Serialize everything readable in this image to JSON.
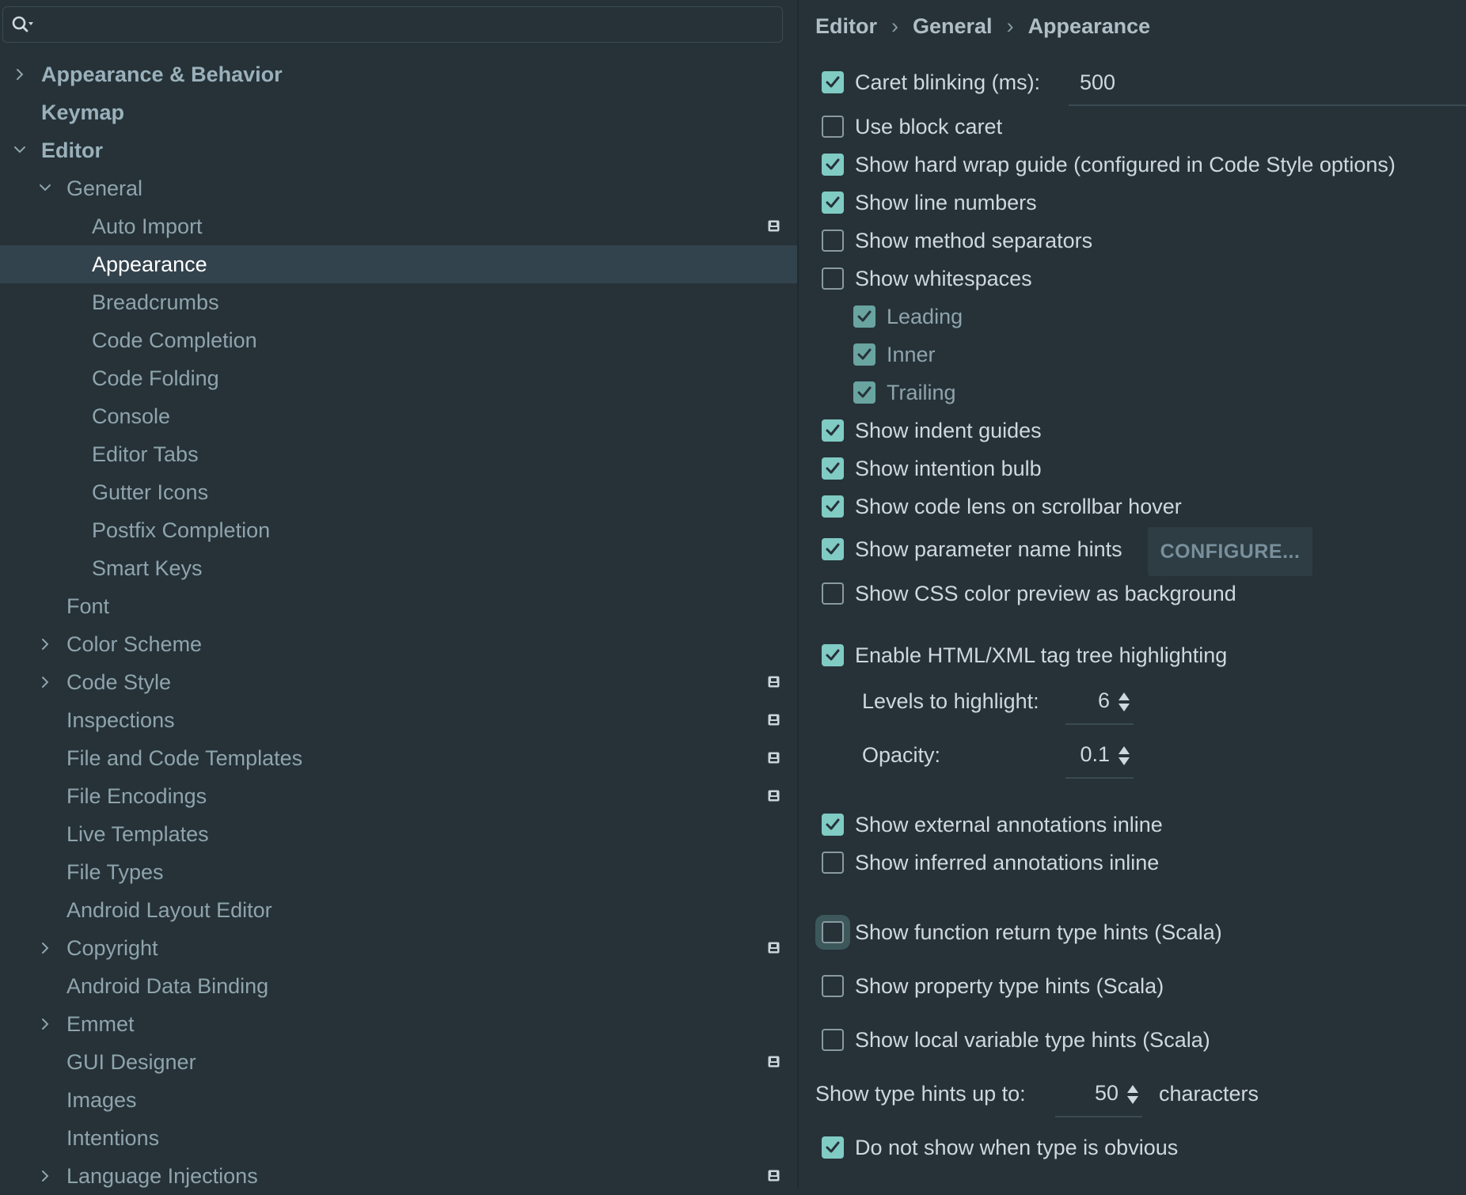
{
  "search": {
    "value": ""
  },
  "tree": [
    {
      "label": "Appearance & Behavior",
      "expandable": true,
      "expanded": false,
      "bold": true
    },
    {
      "label": "Keymap",
      "expandable": false,
      "bold": true
    },
    {
      "label": "Editor",
      "expandable": true,
      "expanded": true,
      "bold": true
    },
    {
      "label": "General",
      "expandable": true,
      "expanded": true
    },
    {
      "label": "Auto Import",
      "project": true
    },
    {
      "label": "Appearance",
      "selected": true
    },
    {
      "label": "Breadcrumbs"
    },
    {
      "label": "Code Completion"
    },
    {
      "label": "Code Folding"
    },
    {
      "label": "Console"
    },
    {
      "label": "Editor Tabs"
    },
    {
      "label": "Gutter Icons"
    },
    {
      "label": "Postfix Completion"
    },
    {
      "label": "Smart Keys"
    },
    {
      "label": "Font"
    },
    {
      "label": "Color Scheme",
      "expandable": true,
      "expanded": false
    },
    {
      "label": "Code Style",
      "expandable": true,
      "expanded": false,
      "project": true
    },
    {
      "label": "Inspections",
      "project": true
    },
    {
      "label": "File and Code Templates",
      "project": true
    },
    {
      "label": "File Encodings",
      "project": true
    },
    {
      "label": "Live Templates"
    },
    {
      "label": "File Types"
    },
    {
      "label": "Android Layout Editor"
    },
    {
      "label": "Copyright",
      "expandable": true,
      "expanded": false,
      "project": true
    },
    {
      "label": "Android Data Binding"
    },
    {
      "label": "Emmet",
      "expandable": true,
      "expanded": false
    },
    {
      "label": "GUI Designer",
      "project": true
    },
    {
      "label": "Images"
    },
    {
      "label": "Intentions"
    },
    {
      "label": "Language Injections",
      "expandable": true,
      "expanded": false,
      "project": true
    }
  ],
  "breadcrumb": [
    "Editor",
    "General",
    "Appearance"
  ],
  "settings": {
    "caret_blinking": {
      "label": "Caret blinking (ms):",
      "checked": true,
      "value": "500"
    },
    "use_block_caret": {
      "label": "Use block caret",
      "checked": false
    },
    "hard_wrap_guide": {
      "label": "Show hard wrap guide (configured in Code Style options)",
      "checked": true
    },
    "line_numbers": {
      "label": "Show line numbers",
      "checked": true
    },
    "method_separators": {
      "label": "Show method separators",
      "checked": false
    },
    "whitespaces": {
      "label": "Show whitespaces",
      "checked": false
    },
    "leading": {
      "label": "Leading",
      "checked": true
    },
    "inner": {
      "label": "Inner",
      "checked": true
    },
    "trailing": {
      "label": "Trailing",
      "checked": true
    },
    "indent_guides": {
      "label": "Show indent guides",
      "checked": true
    },
    "intention_bulb": {
      "label": "Show intention bulb",
      "checked": true
    },
    "code_lens": {
      "label": "Show code lens on scrollbar hover",
      "checked": true
    },
    "param_hints": {
      "label": "Show parameter name hints",
      "checked": true,
      "button": "CONFIGURE..."
    },
    "css_preview": {
      "label": "Show CSS color preview as background",
      "checked": false
    },
    "tag_tree": {
      "label": "Enable HTML/XML tag tree highlighting",
      "checked": true
    },
    "levels": {
      "label": "Levels to highlight:",
      "value": "6"
    },
    "opacity": {
      "label": "Opacity:",
      "value": "0.1"
    },
    "external_annotations": {
      "label": "Show external annotations inline",
      "checked": true
    },
    "inferred_annotations": {
      "label": "Show inferred annotations inline",
      "checked": false
    },
    "return_type_hints": {
      "label": "Show function return type hints (Scala)",
      "checked": false
    },
    "property_type_hints": {
      "label": "Show property type hints (Scala)",
      "checked": false
    },
    "local_var_hints": {
      "label": "Show local variable type hints (Scala)",
      "checked": false
    },
    "type_hints_length": {
      "label": "Show type hints up to:",
      "value": "50",
      "suffix": "characters"
    },
    "obvious_type": {
      "label": "Do not show when type is obvious",
      "checked": true
    }
  },
  "colors": {
    "background": "#263238",
    "selection": "#33434d",
    "accent": "#80cbc4"
  }
}
